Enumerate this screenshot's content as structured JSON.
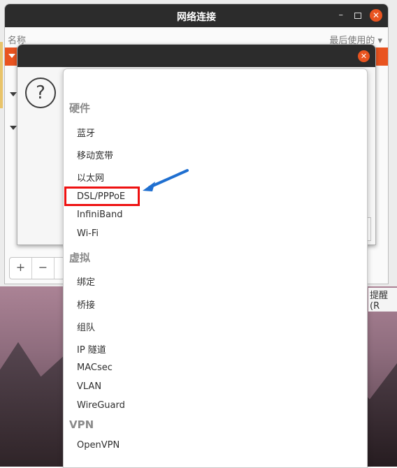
{
  "window": {
    "title": "网络连接",
    "min_glyph": "–",
    "close_glyph": "✕"
  },
  "list": {
    "col_name": "名称",
    "col_last_used": "最后使用的 ▾"
  },
  "toolbar": {
    "add": "+",
    "remove": "−"
  },
  "dialog": {
    "close_glyph": "✕",
    "icon_glyph": "?"
  },
  "menu": {
    "sections": [
      {
        "label": "硬件",
        "items": [
          "蓝牙",
          "移动宽带",
          "以太网",
          "DSL/PPPoE",
          "InfiniBand",
          "Wi-Fi"
        ]
      },
      {
        "label": "虚拟",
        "items": [
          "绑定",
          "桥接",
          "组队",
          "IP 隧道",
          "MACsec",
          "VLAN",
          "WireGuard"
        ]
      },
      {
        "label": "VPN",
        "items": [
          "OpenVPN"
        ]
      }
    ]
  },
  "reminder": "提醒(R",
  "highlight_color": "#ee1111",
  "arrow_color": "#1f6fd0",
  "accent": "#e95420"
}
